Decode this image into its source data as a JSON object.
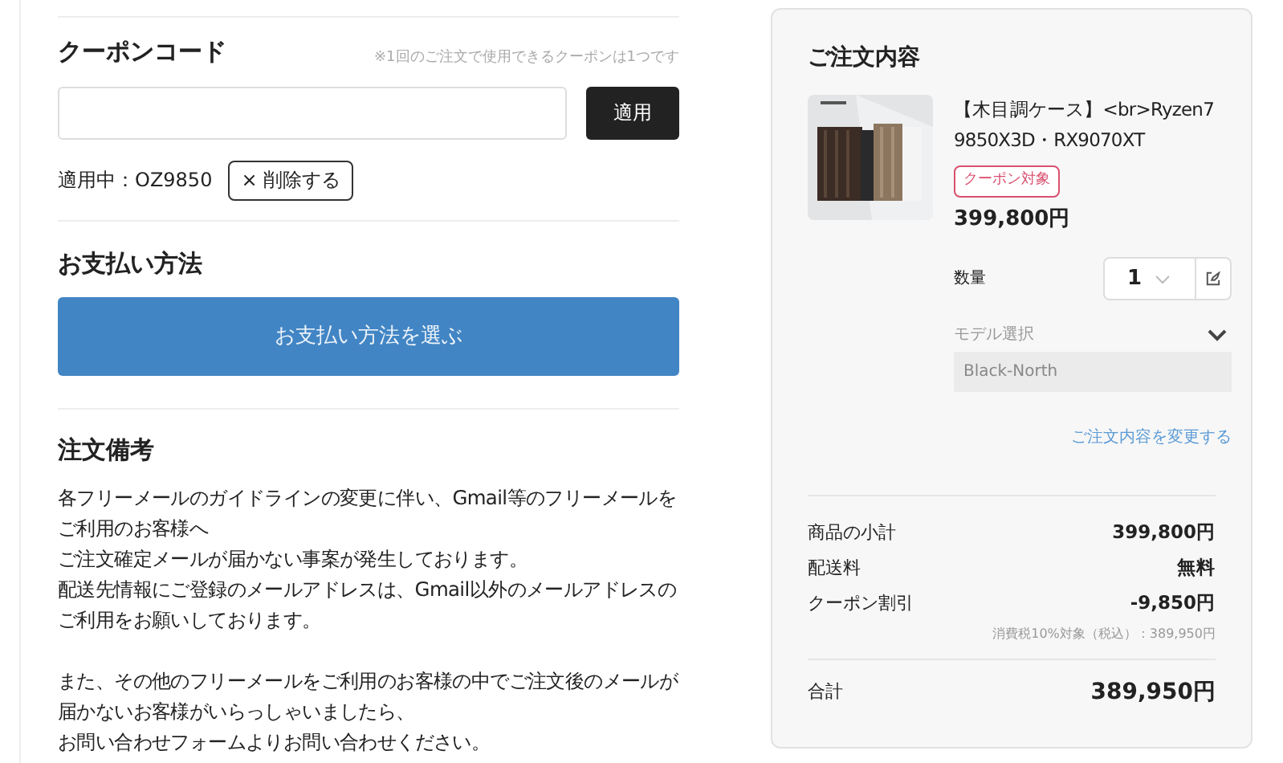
{
  "coupon": {
    "title": "クーポンコード",
    "note": "※1回のご注文で使用できるクーポンは1つです",
    "apply_button": "適用",
    "applied_label": "適用中：OZ9850",
    "remove_button": "× 削除する"
  },
  "payment": {
    "title": "お支払い方法",
    "button": "お支払い方法を選ぶ"
  },
  "notes": {
    "title": "注文備考",
    "paragraphs": [
      [
        "各フリーメールのガイドラインの変更に伴い、Gmail等のフリーメールをご利用のお客様へ",
        "ご注文確定メールが届かない事案が発生しております。",
        "配送先情報にご登録のメールアドレスは、Gmail以外のメールアドレスのご利用をお願いしております。"
      ],
      [
        "また、その他のフリーメールをご利用のお客様の中でご注文後のメールが届かないお客様がいらっしゃいましたら、",
        "お問い合わせフォームよりお問い合わせください。"
      ]
    ]
  },
  "order": {
    "title": "ご注文内容",
    "product": {
      "name": "【木目調ケース】<br>Ryzen7 9850X3D・RX9070XT",
      "badge": "クーポン対象",
      "price": "399,800円",
      "quantity_label": "数量",
      "quantity": "1",
      "model_label": "モデル選択",
      "model_value": "Black-North"
    },
    "change_link": "ご注文内容を変更する",
    "summary": [
      {
        "label": "商品の小計",
        "value": "399,800円"
      },
      {
        "label": "配送料",
        "value": "無料"
      },
      {
        "label": "クーポン割引",
        "value": "-9,850円"
      }
    ],
    "tax_note": "消費税10%対象（税込）：389,950円",
    "total": {
      "label": "合計",
      "value": "389,950円"
    }
  }
}
